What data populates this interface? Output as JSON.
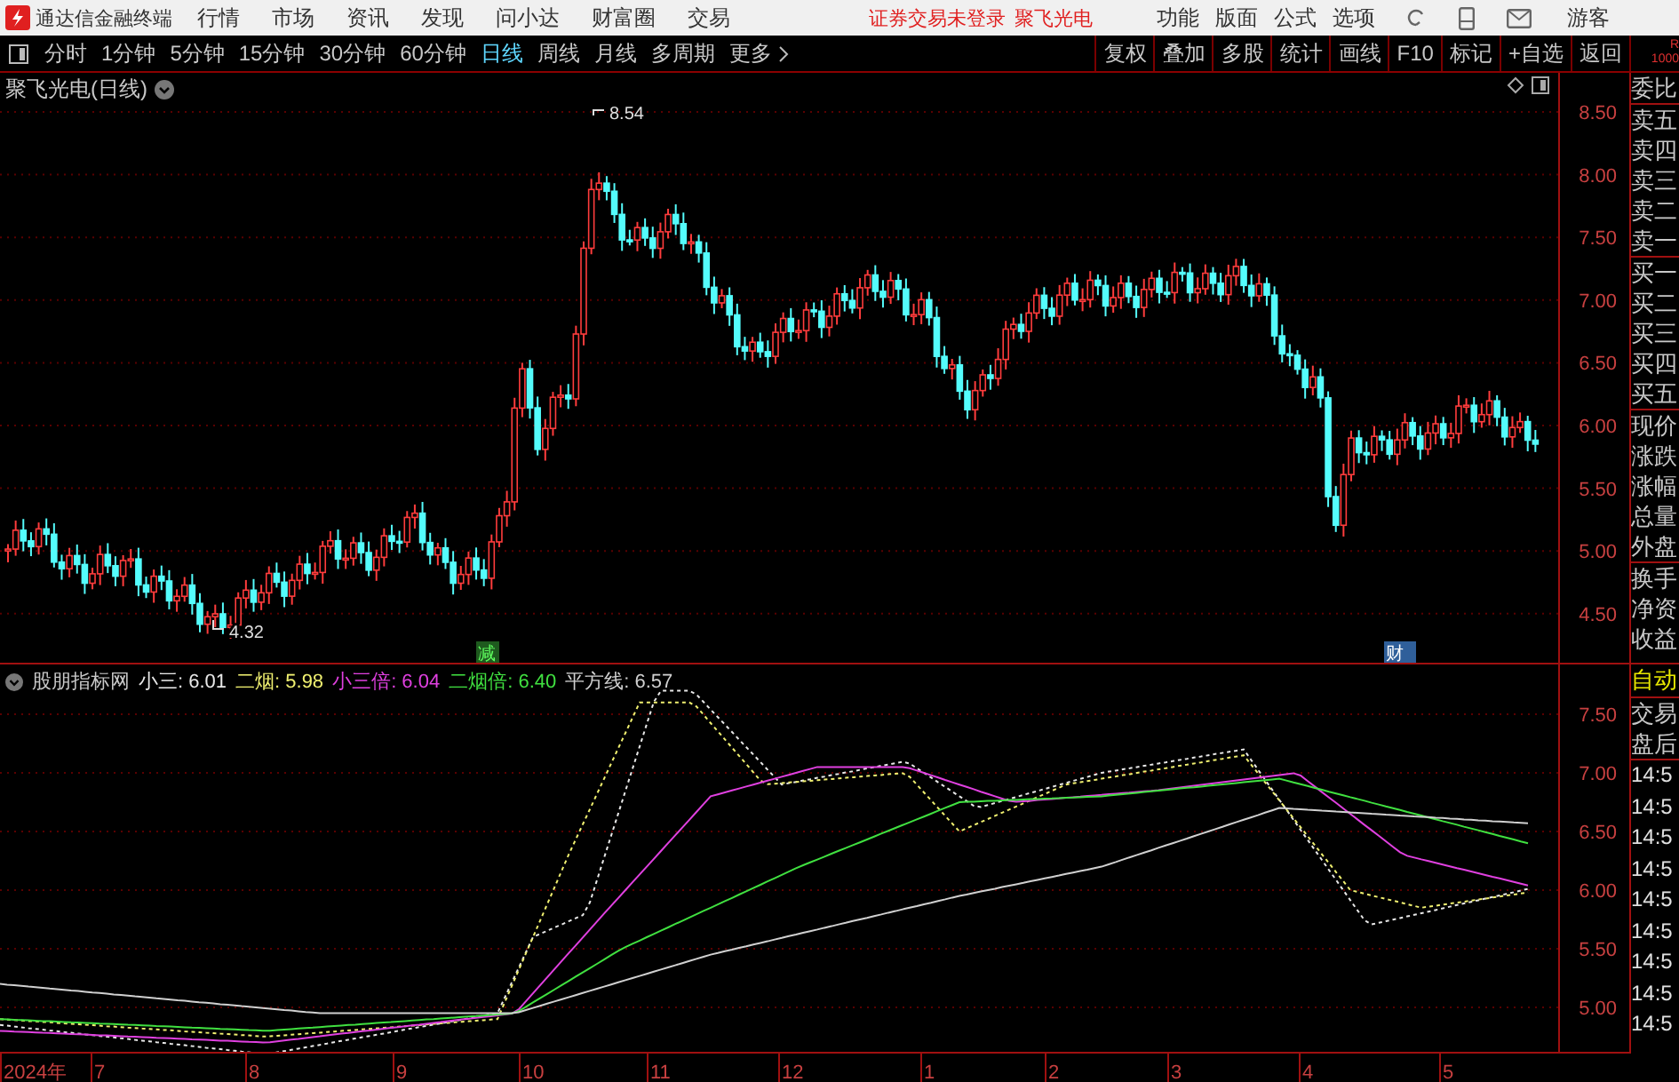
{
  "menu_bar": {
    "app_title": "通达信金融终端",
    "menus": [
      "行情",
      "市场",
      "资讯",
      "发现",
      "问小达",
      "财富圈",
      "交易"
    ],
    "login_notice": "证券交易未登录",
    "stock_name": "聚飞光电",
    "tools": [
      "功能",
      "版面",
      "公式",
      "选项"
    ],
    "user": "游客"
  },
  "period_tabs": [
    {
      "label": "分时",
      "selected": false
    },
    {
      "label": "1分钟",
      "selected": false
    },
    {
      "label": "5分钟",
      "selected": false
    },
    {
      "label": "15分钟",
      "selected": false
    },
    {
      "label": "30分钟",
      "selected": false
    },
    {
      "label": "60分钟",
      "selected": false
    },
    {
      "label": "日线",
      "selected": true
    },
    {
      "label": "周线",
      "selected": false
    },
    {
      "label": "月线",
      "selected": false
    },
    {
      "label": "多周期",
      "selected": false
    }
  ],
  "more_menu": "更多",
  "toolbar_buttons": [
    "复权",
    "叠加",
    "多股",
    "统计",
    "画线",
    "F10",
    "标记",
    "+自选",
    "返回"
  ],
  "corner": [
    "R",
    "1000"
  ],
  "chart": {
    "title": "聚飞光电(日线)",
    "high_label": "8.54",
    "low_label": "4.32",
    "price_ticks": [
      "8.50",
      "8.00",
      "7.50",
      "7.00",
      "6.50",
      "6.00",
      "5.50",
      "5.00",
      "4.50"
    ],
    "event_marks": [
      {
        "label": "减",
        "kind": "reduce"
      },
      {
        "label": "财",
        "kind": "finance"
      }
    ]
  },
  "indicator": {
    "name": "股朋指标网",
    "lines": [
      {
        "name": "小三:",
        "value": "6.01",
        "color": "#e8e8e8"
      },
      {
        "name": "二烟:",
        "value": "5.98",
        "color": "#f0f070"
      },
      {
        "name": "小三倍:",
        "value": "6.04",
        "color": "#e040e0"
      },
      {
        "name": "二烟倍:",
        "value": "6.40",
        "color": "#40e040"
      },
      {
        "name": "平方线:",
        "value": "6.57",
        "color": "#d0d0d0"
      }
    ],
    "ticks": [
      "7.50",
      "7.00",
      "6.50",
      "6.00",
      "5.50",
      "5.00"
    ]
  },
  "date_axis": [
    "2024年",
    "7",
    "8",
    "9",
    "10",
    "11",
    "12",
    "1",
    "2",
    "3",
    "4",
    "5"
  ],
  "quote_panel": {
    "groups": [
      [
        "委比"
      ],
      [
        "卖五",
        "卖四",
        "卖三",
        "卖二",
        "卖一"
      ],
      [
        "买一",
        "买二",
        "买三",
        "买四",
        "买五"
      ],
      [
        "现价",
        "涨跌",
        "涨幅",
        "总量",
        "外盘"
      ],
      [
        "换手",
        "净资",
        "收益"
      ]
    ],
    "mode": "自动",
    "trade_labels": [
      "交易",
      "盘后"
    ],
    "times": [
      "14:5",
      "14:5",
      "14:5",
      "14:5",
      "14:5",
      "14:5",
      "14:5",
      "14:5",
      "14:5"
    ]
  }
}
